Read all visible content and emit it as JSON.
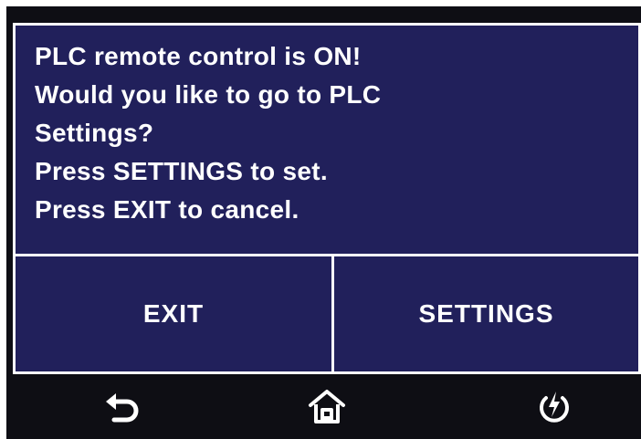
{
  "dialog": {
    "lines": [
      "PLC remote control is ON!",
      "Would you like to go to PLC",
      "Settings?",
      "Press SETTINGS to set.",
      "Press EXIT to cancel."
    ]
  },
  "buttons": {
    "exit_label": "EXIT",
    "settings_label": "SETTINGS"
  },
  "navbar": {
    "icons": [
      "back-icon",
      "home-icon",
      "power-icon"
    ]
  },
  "colors": {
    "panel_background": "#21205b",
    "screen_background": "#0e0e14",
    "text": "#ffffff"
  }
}
